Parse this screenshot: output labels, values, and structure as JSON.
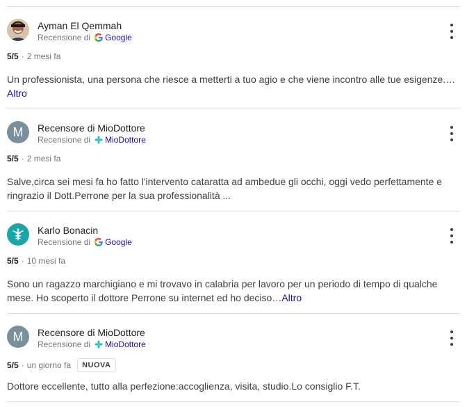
{
  "reviews": [
    {
      "name": "Ayman El Qemmah",
      "source_prefix": "Recensione di",
      "source_name": "Google",
      "source_icon": "google-g-icon",
      "avatar_type": "photo",
      "score": "5/5",
      "separator": "·",
      "time": "2 mesi fa",
      "badge": "",
      "text_line1": "Un professionista, una persona che riesce a metterti a tuo agio e che viene incontro alle tue esigenze.…",
      "text_line2": "",
      "more_label": "Altro"
    },
    {
      "name": "Recensore di MioDottore",
      "source_prefix": "Recensione di",
      "source_name": "MioDottore",
      "source_icon": "miodottore-icon",
      "avatar_letter": "M",
      "avatar_color": "#78909c",
      "score": "5/5",
      "separator": "·",
      "time": "2 mesi fa",
      "badge": "",
      "text_line1": "Salve,circa sei mesi fa ho fatto l'intervento cataratta ad ambedue gli occhi, oggi vedo perfettamente e",
      "text_line2": "ringrazio il Dott.Perrone per la sua professionalità ...",
      "more_label": ""
    },
    {
      "name": "Karlo Bonacin",
      "source_prefix": "Recensione di",
      "source_name": "Google",
      "source_icon": "google-g-icon",
      "avatar_type": "caduceus",
      "avatar_color": "#1aa6a6",
      "score": "5/5",
      "separator": "·",
      "time": "10 mesi fa",
      "badge": "",
      "text_line1": "Sono un ragazzo marchigiano e mi trovavo in calabria per lavoro per un periodo di tempo di qualche",
      "text_line2": "mese. Ho scoperto il dottore Perrone su internet ed ho deciso…",
      "more_label": "Altro"
    },
    {
      "name": "Recensore di MioDottore",
      "source_prefix": "Recensione di",
      "source_name": "MioDottore",
      "source_icon": "miodottore-icon",
      "avatar_letter": "M",
      "avatar_color": "#78909c",
      "score": "5/5",
      "separator": "·",
      "time": "un giorno fa",
      "badge": "NUOVA",
      "text_line1": "Dottore eccellente, tutto alla perfezione:accoglienza, visita, studio.Lo consiglio F.T.",
      "text_line2": "",
      "more_label": ""
    }
  ],
  "colors": {
    "link": "#1a0dab",
    "muted": "#70757a",
    "divider": "#dadce0",
    "miodottore_accent": "#21c1b1"
  }
}
